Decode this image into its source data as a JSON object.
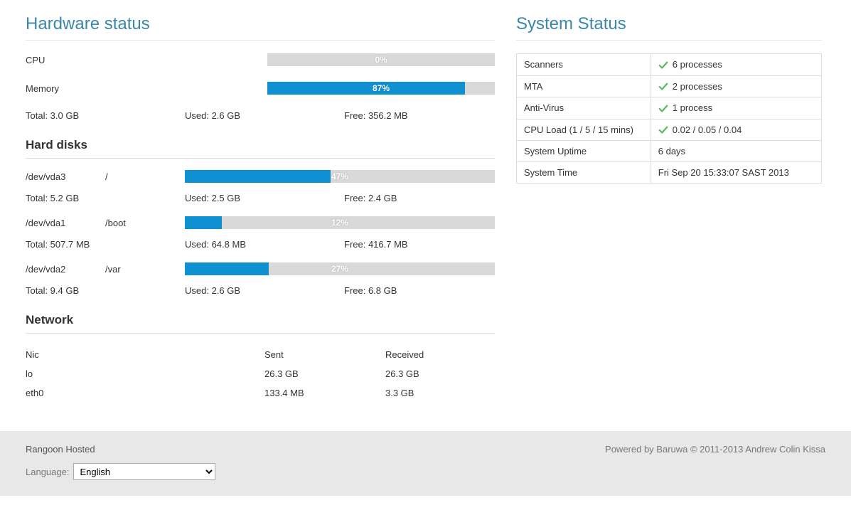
{
  "hardware_title": "Hardware status",
  "cpu": {
    "label": "CPU",
    "percent": 0,
    "percent_text": "0%"
  },
  "memory": {
    "label": "Memory",
    "percent": 87,
    "percent_text": "87%",
    "total_label": "Total: 3.0 GB",
    "used_label": "Used: 2.6 GB",
    "free_label": "Free: 356.2 MB"
  },
  "harddisks_title": "Hard disks",
  "disks": [
    {
      "dev": "/dev/vda3",
      "mount": "/",
      "percent": 47,
      "percent_text": "47%",
      "total_label": "Total: 5.2 GB",
      "used_label": "Used: 2.5 GB",
      "free_label": "Free: 2.4 GB"
    },
    {
      "dev": "/dev/vda1",
      "mount": "/boot",
      "percent": 12,
      "percent_text": "12%",
      "total_label": "Total: 507.7 MB",
      "used_label": "Used: 64.8 MB",
      "free_label": "Free: 416.7 MB"
    },
    {
      "dev": "/dev/vda2",
      "mount": "/var",
      "percent": 27,
      "percent_text": "27%",
      "total_label": "Total: 9.4 GB",
      "used_label": "Used: 2.6 GB",
      "free_label": "Free: 6.8 GB"
    }
  ],
  "network_title": "Network",
  "network_header": {
    "nic": "Nic",
    "sent": "Sent",
    "received": "Received"
  },
  "nics": [
    {
      "name": "lo",
      "sent": "26.3 GB",
      "received": "26.3 GB"
    },
    {
      "name": "eth0",
      "sent": "133.4 MB",
      "received": "3.3 GB"
    }
  ],
  "system_status_title": "System Status",
  "status_rows": [
    {
      "label": "Scanners",
      "check": true,
      "value": "6 processes"
    },
    {
      "label": "MTA",
      "check": true,
      "value": "2 processes"
    },
    {
      "label": "Anti-Virus",
      "check": true,
      "value": "1 process"
    },
    {
      "label": "CPU Load (1 / 5 / 15 mins)",
      "check": true,
      "value": "0.02 / 0.05 / 0.04"
    },
    {
      "label": "System Uptime",
      "check": false,
      "value": "6 days"
    },
    {
      "label": "System Time",
      "check": false,
      "value": "Fri Sep 20 15:33:07 SAST 2013"
    }
  ],
  "footer": {
    "host": "Rangoon Hosted",
    "language_label": "Language:",
    "language_value": "English",
    "powered": "Powered by Baruwa © 2011-2013 Andrew Colin Kissa"
  }
}
